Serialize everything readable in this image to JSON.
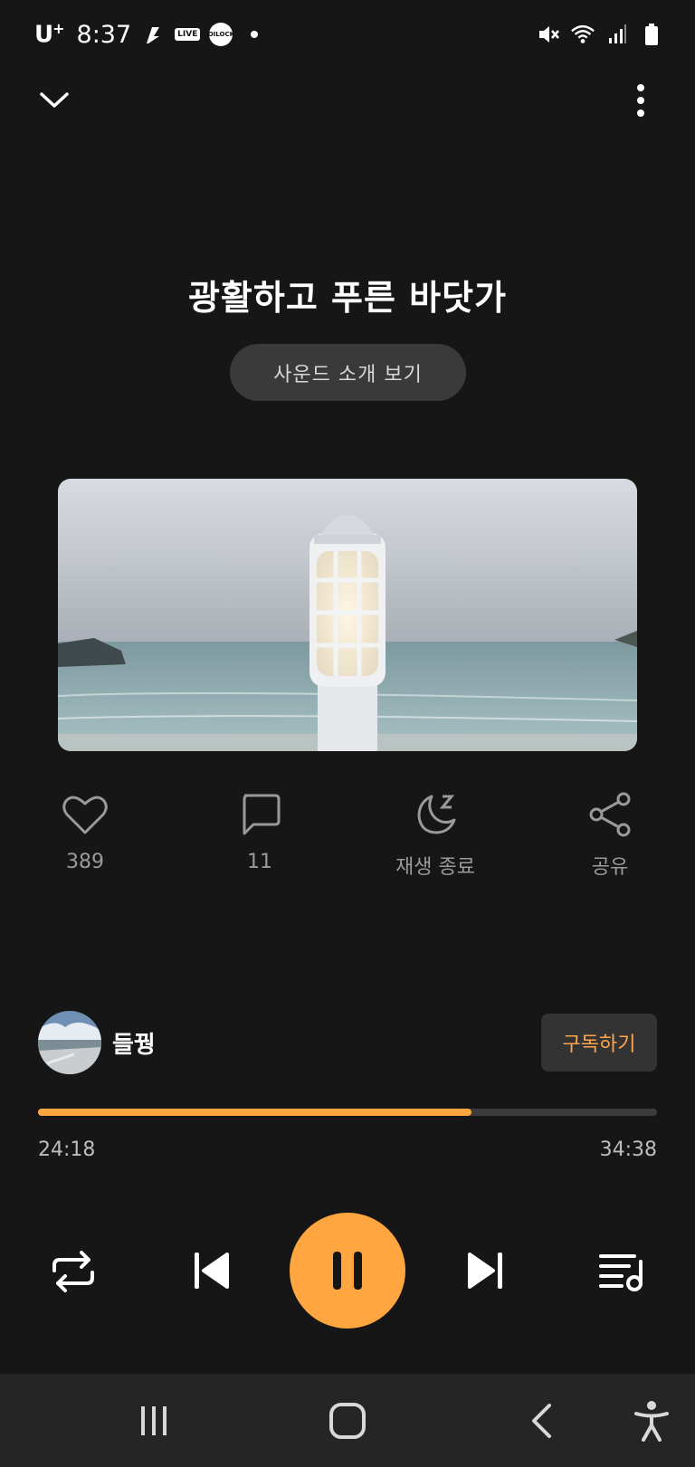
{
  "status_bar": {
    "carrier": "U",
    "carrier_sup": "+",
    "time": "8:37",
    "live_badge": "LIVE",
    "lock_badge_line1": "OI",
    "lock_badge_line2": "LOCK"
  },
  "header": {
    "collapse_icon": "chevron-down-icon",
    "more_icon": "more-vertical-icon"
  },
  "track": {
    "title": "광활하고 푸른 바닷가",
    "intro_button": "사운드 소개 보기"
  },
  "actions": [
    {
      "icon": "heart-icon",
      "label": "389"
    },
    {
      "icon": "comment-icon",
      "label": "11"
    },
    {
      "icon": "sleep-timer-icon",
      "label": "재생 종료"
    },
    {
      "icon": "share-icon",
      "label": "공유"
    }
  ],
  "creator": {
    "name": "들꿩",
    "subscribe_label": "구독하기"
  },
  "progress": {
    "current_time": "24:18",
    "total_time": "34:38",
    "fraction": 0.7
  },
  "controls": {
    "repeat_icon": "repeat-icon",
    "previous_icon": "skip-previous-icon",
    "play_pause_icon": "pause-icon",
    "next_icon": "skip-next-icon",
    "playlist_icon": "playlist-icon"
  },
  "colors": {
    "accent": "#ffa640",
    "background": "#161616",
    "subscribe_text": "#ffa64d"
  }
}
